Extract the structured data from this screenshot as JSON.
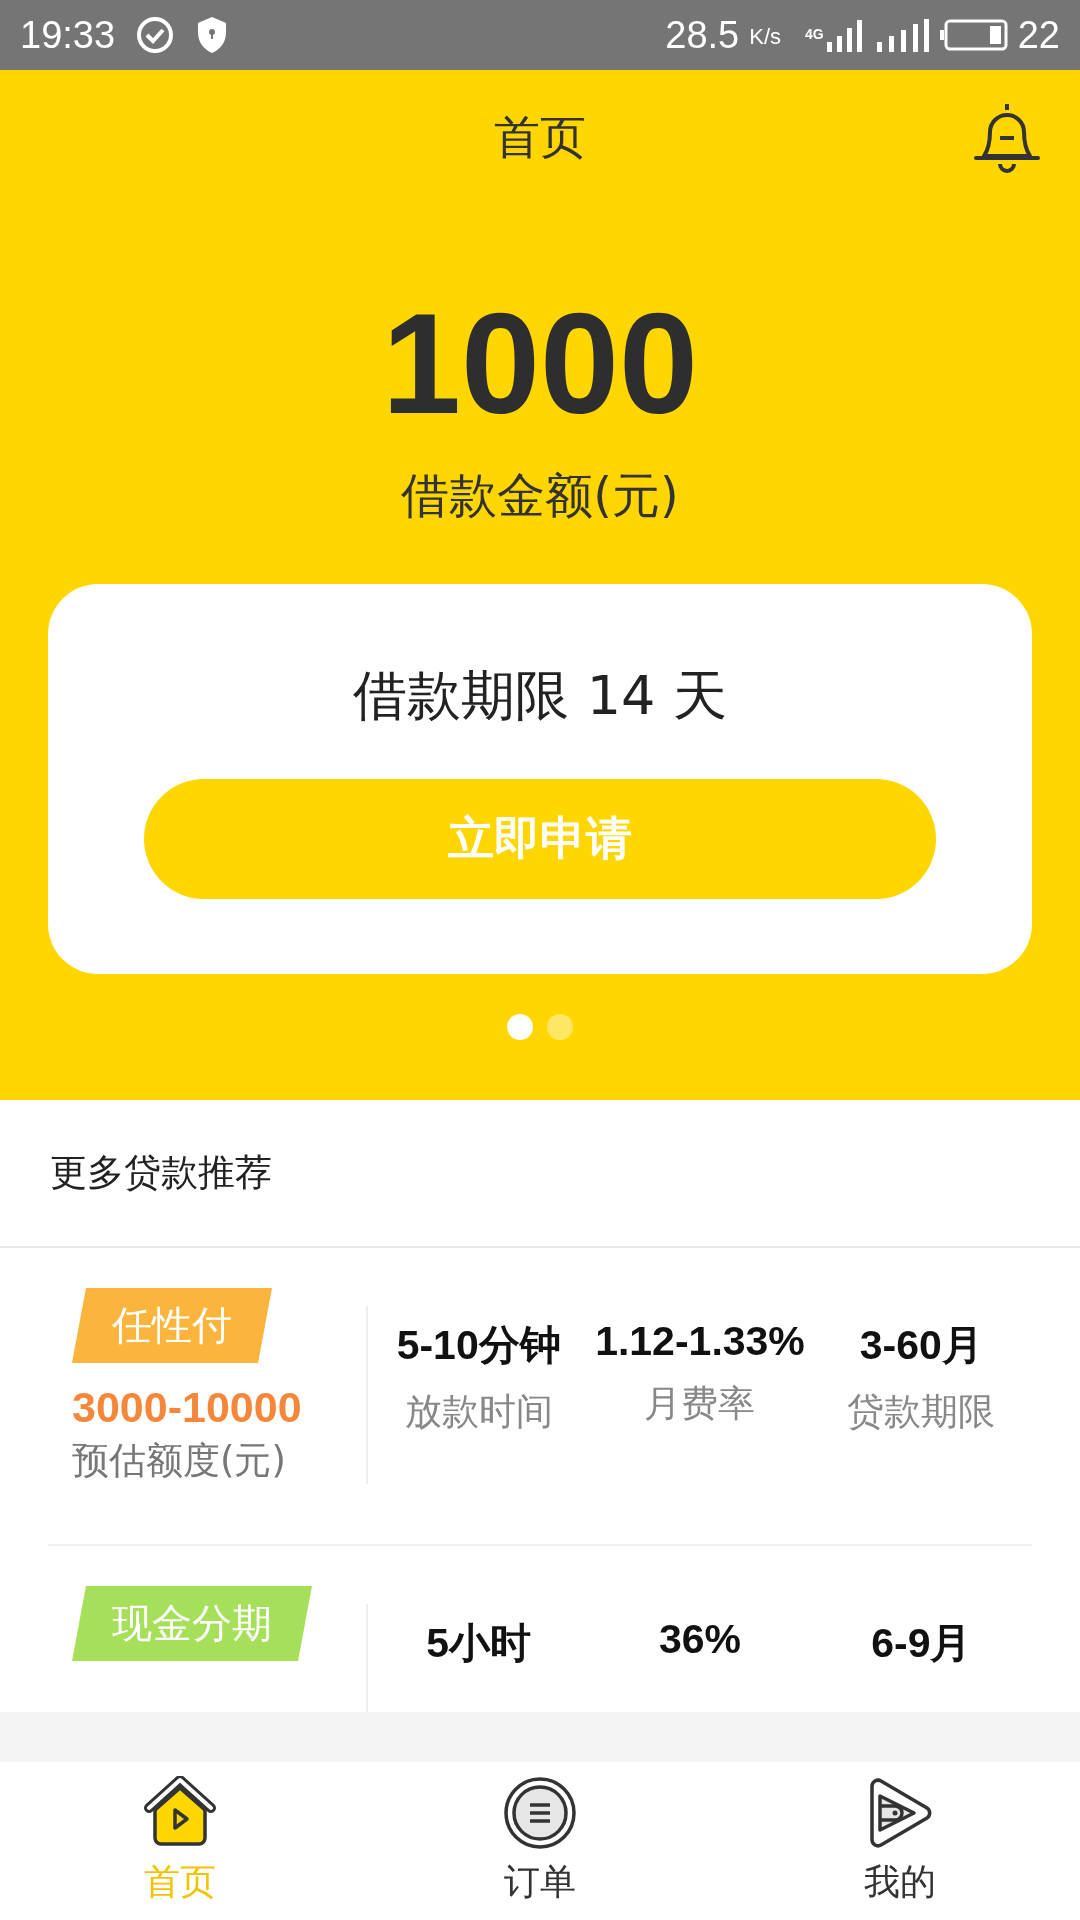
{
  "status_bar": {
    "time": "19:33",
    "speed": "28.5",
    "speed_unit": "K/s",
    "network": "4G",
    "battery": "22"
  },
  "header": {
    "title": "首页"
  },
  "hero": {
    "amount": "1000",
    "amount_label": "借款金额(元)"
  },
  "card": {
    "term": "借款期限 14 天",
    "apply_button": "立即申请"
  },
  "carousel_dots": [
    {
      "selected": true
    },
    {
      "selected": false
    }
  ],
  "section_title": "更多贷款推荐",
  "loans": [
    {
      "name": "任性付",
      "color": "#fbb43c",
      "amount": "3000-10000",
      "amount_label": "预估额度(元)",
      "stats": [
        {
          "value": "5-10分钟",
          "label": "放款时间"
        },
        {
          "value": "1.12-1.33%",
          "label": "月费率"
        },
        {
          "value": "3-60月",
          "label": "贷款期限"
        }
      ]
    },
    {
      "name": "现金分期",
      "color": "#a6e05b",
      "stats": [
        {
          "value": "5小时"
        },
        {
          "value": "36%"
        },
        {
          "value": "6-9月"
        }
      ]
    }
  ],
  "tab_bar": [
    {
      "kind": "home",
      "label": "首页",
      "selected": true
    },
    {
      "kind": "orders",
      "label": "订单",
      "selected": false
    },
    {
      "kind": "me",
      "label": "我的",
      "selected": false
    }
  ]
}
